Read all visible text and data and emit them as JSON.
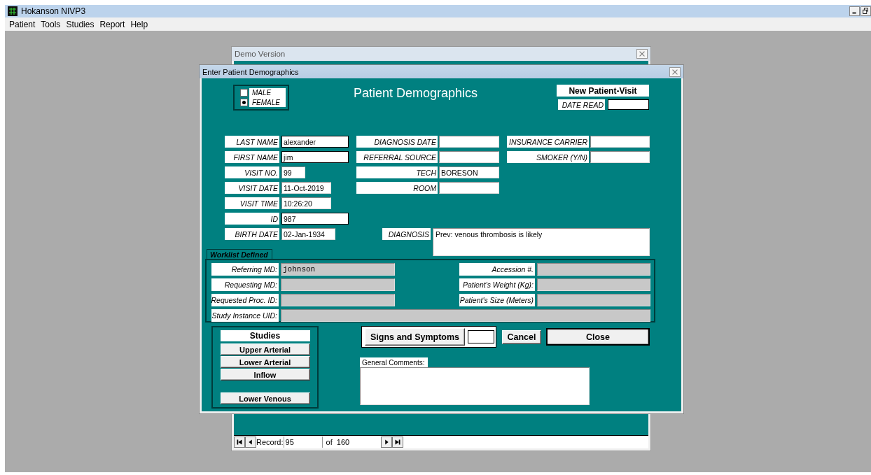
{
  "app": {
    "title": "Hokanson NIVP3",
    "menu": [
      "Patient",
      "Tools",
      "Studies",
      "Report",
      "Help"
    ]
  },
  "background_window": {
    "title": "Demo Version",
    "navigator": {
      "label": "Record:",
      "record": "95",
      "total": "of  160"
    }
  },
  "dialog": {
    "title": "Enter Patient Demographics",
    "heading": "Patient Demographics",
    "sex_options": [
      {
        "label": "MALE",
        "selected": false
      },
      {
        "label": "FEMALE",
        "selected": true
      }
    ],
    "visit_type": "New Patient-Visit",
    "date_read_label": "DATE READ",
    "field_columns": [
      [
        {
          "label": "LAST NAME",
          "value": "alexander"
        },
        {
          "label": "FIRST NAME",
          "value": "jim"
        },
        {
          "label": "VISIT NO.",
          "value": "99"
        },
        {
          "label": "VISIT DATE",
          "value": "11-Oct-2019"
        },
        {
          "label": "VISIT TIME",
          "value": "10:26:20"
        },
        {
          "label": "ID",
          "value": "987"
        },
        {
          "label": "BIRTH DATE",
          "value": "02-Jan-1934"
        }
      ],
      [
        {
          "label": "DIAGNOSIS DATE"
        },
        {
          "label": "REFERRAL SOURCE"
        },
        {
          "label": "TECH",
          "value": "BORESON"
        },
        {
          "label": "ROOM"
        }
      ],
      [
        {
          "label": "INSURANCE CARRIER"
        },
        {
          "label": "SMOKER (Y/N)"
        }
      ]
    ],
    "diagnosis": {
      "label": "DIAGNOSIS",
      "value": "Prev: venous thrombosis is likely"
    },
    "worklist": {
      "tab": "Worklist Defined",
      "left": [
        {
          "label": "Referring MD:",
          "value": "johnson"
        },
        {
          "label": "Requesting MD:"
        },
        {
          "label": "Requested Proc. ID:"
        }
      ],
      "right": [
        {
          "label": "Accession #."
        },
        {
          "label": "Patient's Weight (Kg):"
        },
        {
          "label": "Patient's Size (Meters)"
        }
      ],
      "uid_label": "Study Instance UID:"
    },
    "studies": {
      "title": "Studies",
      "buttons": [
        "Upper Arterial",
        "Lower Arterial",
        "Inflow",
        "Lower Venous"
      ]
    },
    "signs_button": "Signs and Symptoms",
    "cancel_button": "Cancel",
    "close_button": "Close",
    "comments_label": "General Comments:"
  }
}
